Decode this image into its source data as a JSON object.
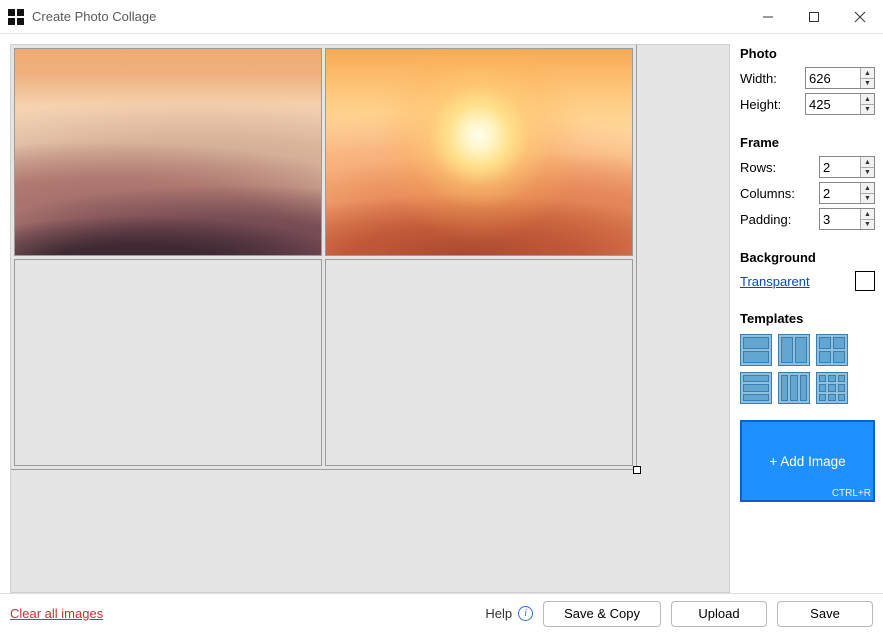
{
  "titlebar": {
    "title": "Create Photo Collage"
  },
  "photo": {
    "header": "Photo",
    "width_label": "Width:",
    "width_value": "626",
    "height_label": "Height:",
    "height_value": "425"
  },
  "frame": {
    "header": "Frame",
    "rows_label": "Rows:",
    "rows_value": "2",
    "cols_label": "Columns:",
    "cols_value": "2",
    "padding_label": "Padding:",
    "padding_value": "3"
  },
  "background": {
    "header": "Background",
    "link": "Transparent"
  },
  "templates": {
    "header": "Templates"
  },
  "add_image": {
    "label": "+ Add Image",
    "shortcut": "CTRL+R"
  },
  "footer": {
    "clear": "Clear all images",
    "help": "Help",
    "save_copy": "Save & Copy",
    "upload": "Upload",
    "save": "Save"
  },
  "collage": {
    "cells": [
      {
        "image": "mountains-haze"
      },
      {
        "image": "mountains-sunset"
      },
      {
        "image": null
      },
      {
        "image": null
      }
    ]
  }
}
